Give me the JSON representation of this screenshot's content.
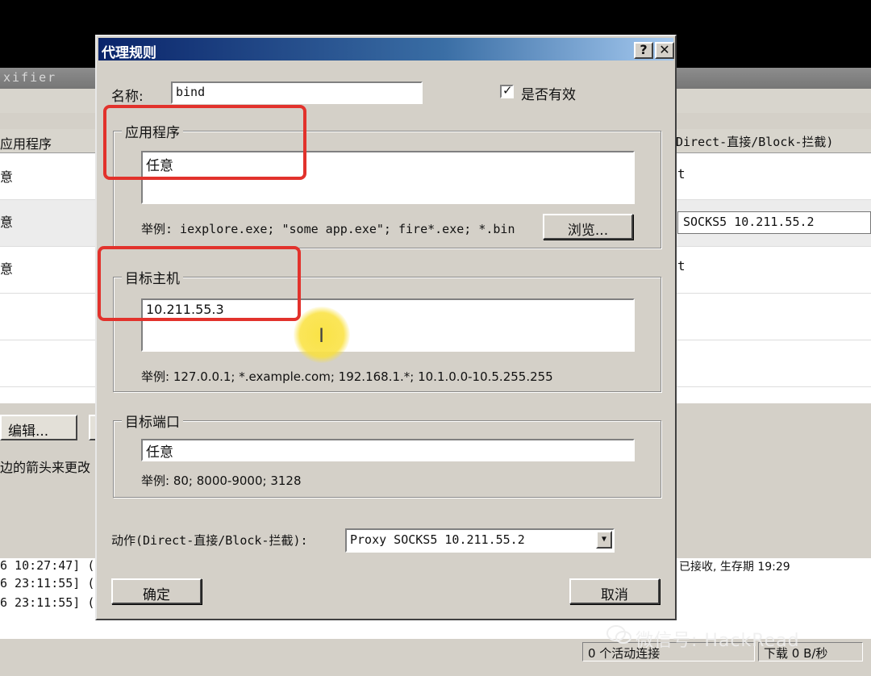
{
  "background_window": {
    "title_fragment": "xifier",
    "table": {
      "header_app": "应用程序",
      "header_action": "Direct-直接/Block-拦截)",
      "rows": [
        {
          "app": "意",
          "action": "t"
        },
        {
          "app": "意",
          "action": "SOCKS5 10.211.55.2"
        },
        {
          "app": "意",
          "action": "t"
        }
      ]
    },
    "edit_button": "编辑...",
    "hint_text": "边的箭头来更改",
    "log_lines": [
      "6 10:27:47] (",
      "6 23:11:55] (",
      "6 23:11:55] ("
    ],
    "log_right_fragment": "已接收, 生存期 19:29",
    "status": {
      "connections": "0 个活动连接",
      "download": "下载 0 B/秒"
    }
  },
  "watermark": "微信号: HackRead",
  "dialog": {
    "title": "代理规则",
    "help_button": "?",
    "close_button": "✕",
    "name_label": "名称:",
    "name_value": "bind",
    "enabled_label": "是否有效",
    "enabled_checked": "✓",
    "applications": {
      "legend": "应用程序",
      "value": "任意",
      "example": "举例: iexplore.exe; \"some app.exe\"; fire*.exe; *.bin",
      "browse_button": "浏览..."
    },
    "target_hosts": {
      "legend": "目标主机",
      "value": "10.211.55.3",
      "example": "举例: 127.0.0.1; *.example.com; 192.168.1.*; 10.1.0.0-10.5.255.255"
    },
    "target_ports": {
      "legend": "目标端口",
      "value": "任意",
      "example": "举例: 80; 8000-9000; 3128"
    },
    "action_label": "动作(Direct-直接/Block-拦截):",
    "action_value": "Proxy SOCKS5 10.211.55.2",
    "ok_button": "确定",
    "cancel_button": "取消"
  },
  "colors": {
    "annotation_red": "#e2322c",
    "cursor_highlight": "#fae13c",
    "title_bar": "#0a246a"
  }
}
